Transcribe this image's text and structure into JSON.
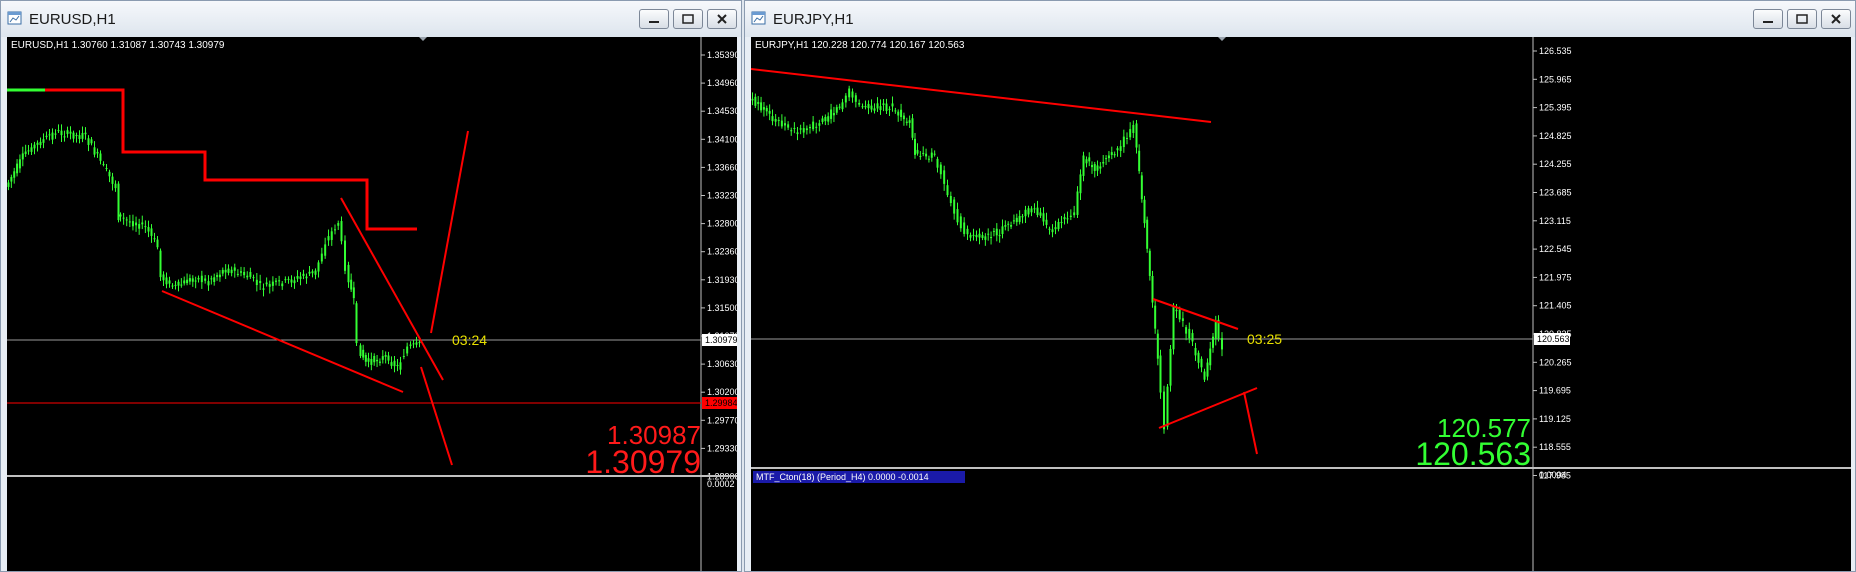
{
  "windows": [
    {
      "id": "eurusd",
      "title": "EURUSD,H1",
      "info": "EURUSD,H1  1.30760 1.31087 1.30743 1.30979",
      "price_labels": [
        "1.35390",
        "1.34960",
        "1.34530",
        "1.34100",
        "1.33660",
        "1.33230",
        "1.32800",
        "1.32360",
        "1.31930",
        "1.31500",
        "1.31070",
        "1.30630",
        "1.30200",
        "1.29770",
        "1.29330",
        "1.28900"
      ],
      "current_price_label": "1.30979",
      "red_line_label": "1.29984",
      "timer": "03:24",
      "big_top": "1.30987",
      "big_bottom": "1.30979",
      "indicator_color": "#ff0000",
      "candle_color": "#33ff33",
      "lower_panel_label": "0.0002"
    },
    {
      "id": "eurjpy",
      "title": "EURJPY,H1",
      "info": "EURJPY,H1  120.228 120.774 120.167 120.563",
      "price_labels": [
        "126.535",
        "125.965",
        "125.395",
        "124.825",
        "124.255",
        "123.685",
        "123.115",
        "122.545",
        "121.975",
        "121.405",
        "120.835",
        "120.265",
        "119.695",
        "119.125",
        "118.555",
        "117.985"
      ],
      "current_price_label": "120.563",
      "timer": "03:25",
      "big_top": "120.577",
      "big_bottom": "120.563",
      "indicator_label": "MTF_Cton(18) (Period_H4) 0.0000 -0.0014",
      "lower_panel_label": "0.0004",
      "candle_color": "#33ff33",
      "bid_color": "#33ff33"
    }
  ],
  "icons": {
    "chart": "chart-window-icon",
    "minimize": "minimize-icon",
    "maximize": "maximize-icon",
    "close": "close-icon"
  }
}
